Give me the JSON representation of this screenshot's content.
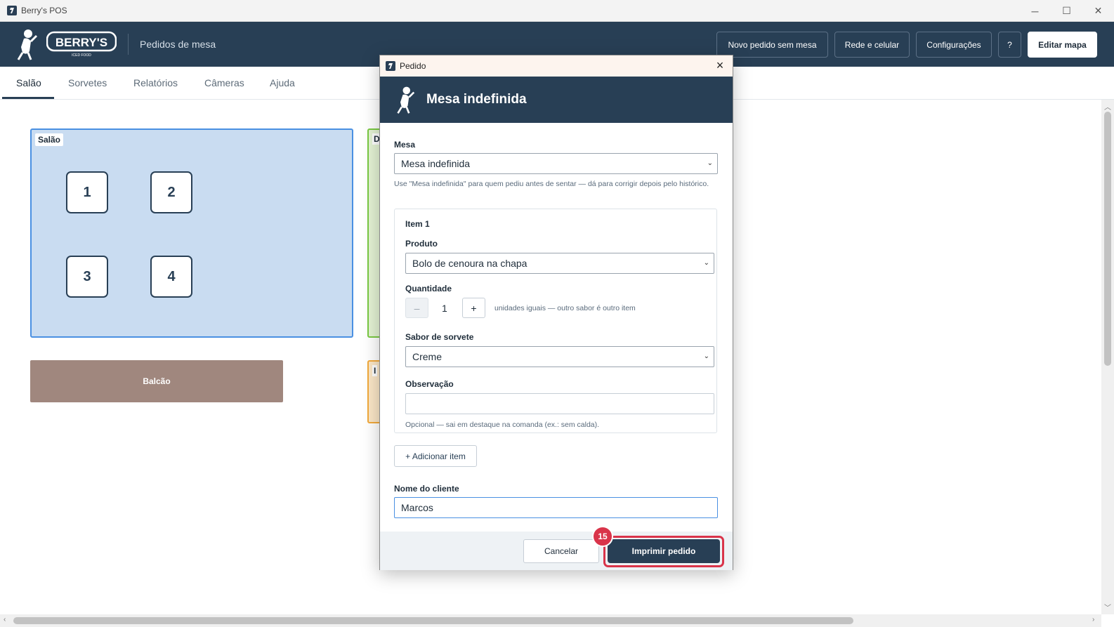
{
  "window": {
    "title": "Berry's POS",
    "controls": {
      "minimize": "─",
      "maximize": "☐",
      "close": "✕"
    }
  },
  "header": {
    "brand_alt": "BERRY'S ICED FOOD",
    "page_title": "Pedidos de mesa",
    "buttons": {
      "new_order": "Novo pedido sem mesa",
      "network": "Rede e celular",
      "settings": "Configurações",
      "help": "?",
      "edit_map": "Editar mapa"
    }
  },
  "tabs": [
    "Salão",
    "Sorvetes",
    "Relatórios",
    "Câmeras",
    "Ajuda"
  ],
  "active_tab": "Salão",
  "floor": {
    "salao_label": "Salão",
    "tables": [
      "1",
      "2",
      "3",
      "4"
    ],
    "balcao_label": "Balcão",
    "green_area_label": "D",
    "orange_area_label": "I"
  },
  "modal": {
    "window_title": "Pedido",
    "hero_title": "Mesa indefinida",
    "mesa_label": "Mesa",
    "mesa_value": "Mesa indefinida",
    "mesa_hint": "Use \"Mesa indefinida\" para quem pediu antes de sentar — dá para corrigir depois pelo histórico.",
    "item": {
      "title": "Item 1",
      "produto_label": "Produto",
      "produto_value": "Bolo de cenoura na chapa",
      "quantidade_label": "Quantidade",
      "quantidade_minus": "–",
      "quantidade_value": "1",
      "quantidade_plus": "+",
      "quantidade_hint": "unidades iguais — outro sabor é outro item",
      "sabor_label": "Sabor de sorvete",
      "sabor_value": "Creme",
      "observacao_label": "Observação",
      "observacao_value": "",
      "observacao_hint": "Opcional — sai em destaque na comanda (ex.: sem calda)."
    },
    "add_item": "+ Adicionar item",
    "cliente_label": "Nome do cliente",
    "cliente_value": "Marcos",
    "cancel": "Cancelar",
    "print": "Imprimir pedido",
    "step_badge": "15"
  },
  "colors": {
    "brand_navy": "#283f55",
    "salao_fill": "#c9dcf1",
    "salao_border": "#4a90e2",
    "balcao_fill": "#a0877e",
    "highlight_red": "#d9344a"
  }
}
